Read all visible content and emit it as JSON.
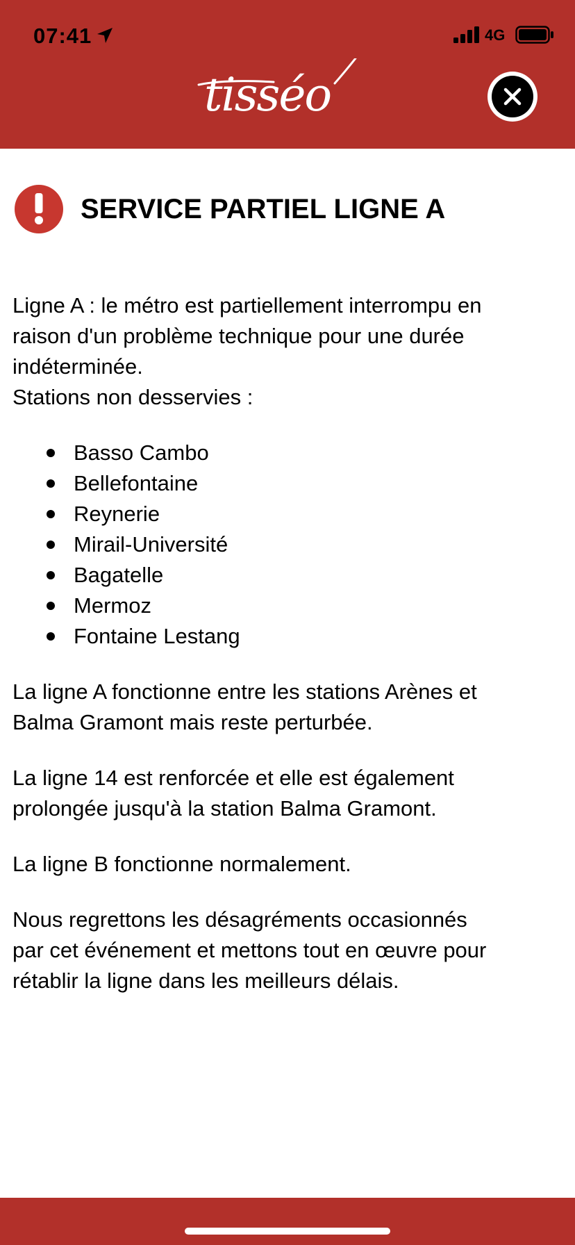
{
  "status_bar": {
    "time": "07:41",
    "network": "4G"
  },
  "header": {
    "logo_text": "tisséo",
    "close_icon": "close-icon"
  },
  "alert": {
    "icon": "exclamation-icon",
    "title": "SERVICE PARTIEL LIGNE A",
    "intro_lines": [
      "Ligne A : le métro est partiellement interrompu en",
      "raison d'un problème technique pour une durée",
      "indéterminée.",
      "Stations non desservies :"
    ],
    "stations": [
      "Basso Cambo",
      "Bellefontaine",
      "Reynerie",
      "Mirail-Université",
      "Bagatelle",
      "Mermoz",
      "Fontaine Lestang"
    ],
    "paragraphs": [
      [
        "La ligne A fonctionne entre les stations Arènes et",
        "Balma Gramont mais reste perturbée."
      ],
      [
        "La ligne 14 est renforcée et elle est également",
        "prolongée jusqu'à la station Balma Gramont."
      ],
      [
        "La ligne B fonctionne normalement."
      ],
      [
        "Nous regrettons les désagréments occasionnés",
        "par cet événement et mettons tout en œuvre pour",
        "rétablir la ligne dans les meilleurs délais."
      ]
    ]
  },
  "colors": {
    "brand_red": "#b2302a",
    "alert_red": "#c7372f",
    "text": "#000000",
    "background": "#ffffff"
  }
}
